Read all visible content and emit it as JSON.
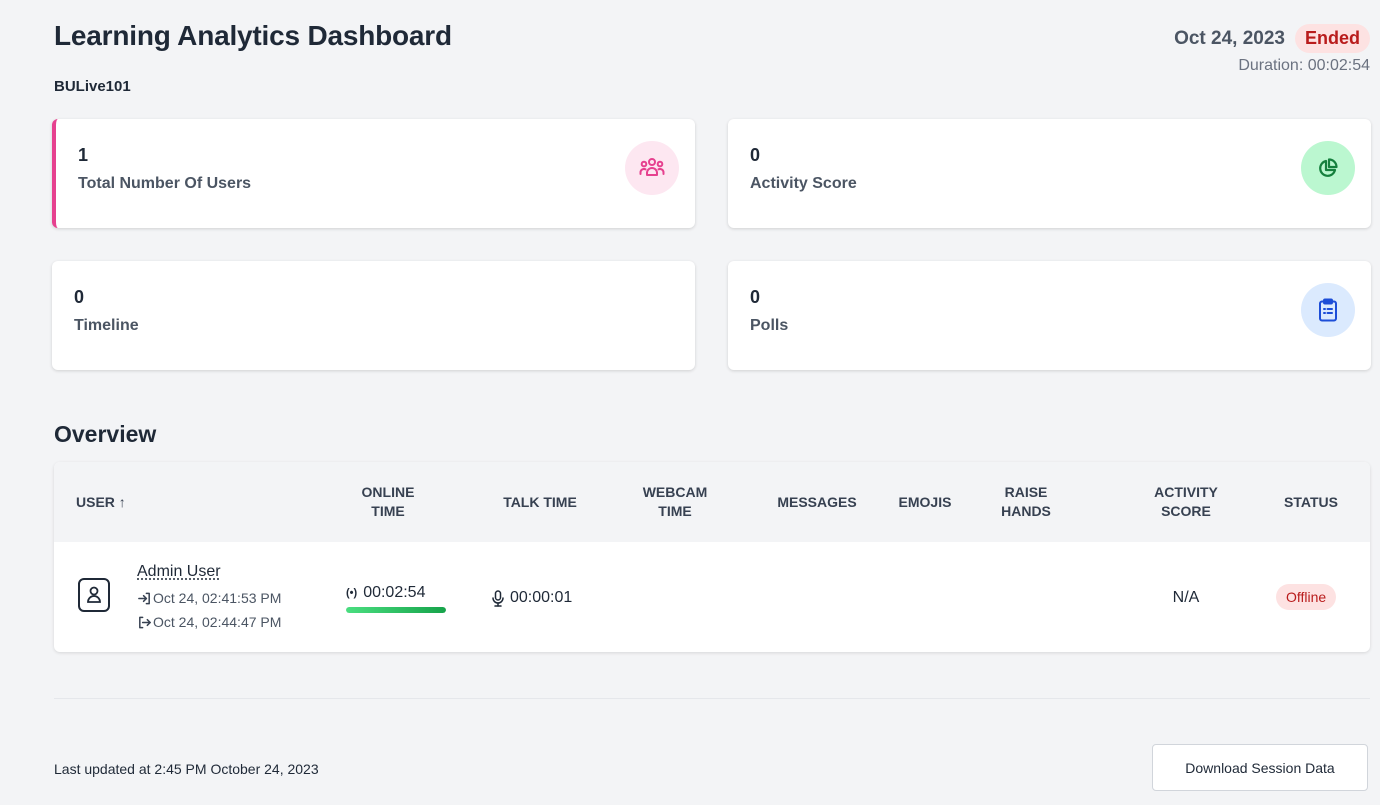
{
  "header": {
    "title": "Learning Analytics Dashboard",
    "meeting_name": "BULive101",
    "date": "Oct 24, 2023",
    "status": "Ended",
    "duration_label": "Duration: 00:02:54"
  },
  "cards": {
    "users": {
      "value": "1",
      "label": "Total Number Of Users",
      "icon": "users-icon",
      "color": "#e6418f",
      "bg": "#fde7f1"
    },
    "activity": {
      "value": "0",
      "label": "Activity Score",
      "icon": "pie-chart-icon",
      "color": "#16a34a",
      "bg": "#bbf7d0"
    },
    "timeline": {
      "value": "0",
      "label": "Timeline"
    },
    "polls": {
      "value": "0",
      "label": "Polls",
      "icon": "clipboard-list-icon",
      "color": "#2563eb",
      "bg": "#dbeafe"
    }
  },
  "overview": {
    "title": "Overview",
    "columns": {
      "user": "User ↑",
      "online_time": "Online Time",
      "talk_time": "Talk Time",
      "webcam_time": "Webcam Time",
      "messages": "Messages",
      "emojis": "Emojis",
      "raise_hands": "Raise Hands",
      "activity_score": "Activity Score",
      "status": "Status"
    },
    "rows": [
      {
        "name": "Admin User",
        "joined": "Oct 24, 02:41:53 PM",
        "left": "Oct 24, 02:44:47 PM",
        "online_time": "00:02:54",
        "online_progress": 1.0,
        "talk_time": "00:00:01",
        "webcam_time": "",
        "messages": "",
        "emojis": "",
        "raise_hands": "",
        "activity_score": "N/A",
        "status": "Offline"
      }
    ]
  },
  "footer": {
    "last_updated": "Last updated at 2:45 PM October 24, 2023",
    "download_label": "Download Session Data"
  }
}
